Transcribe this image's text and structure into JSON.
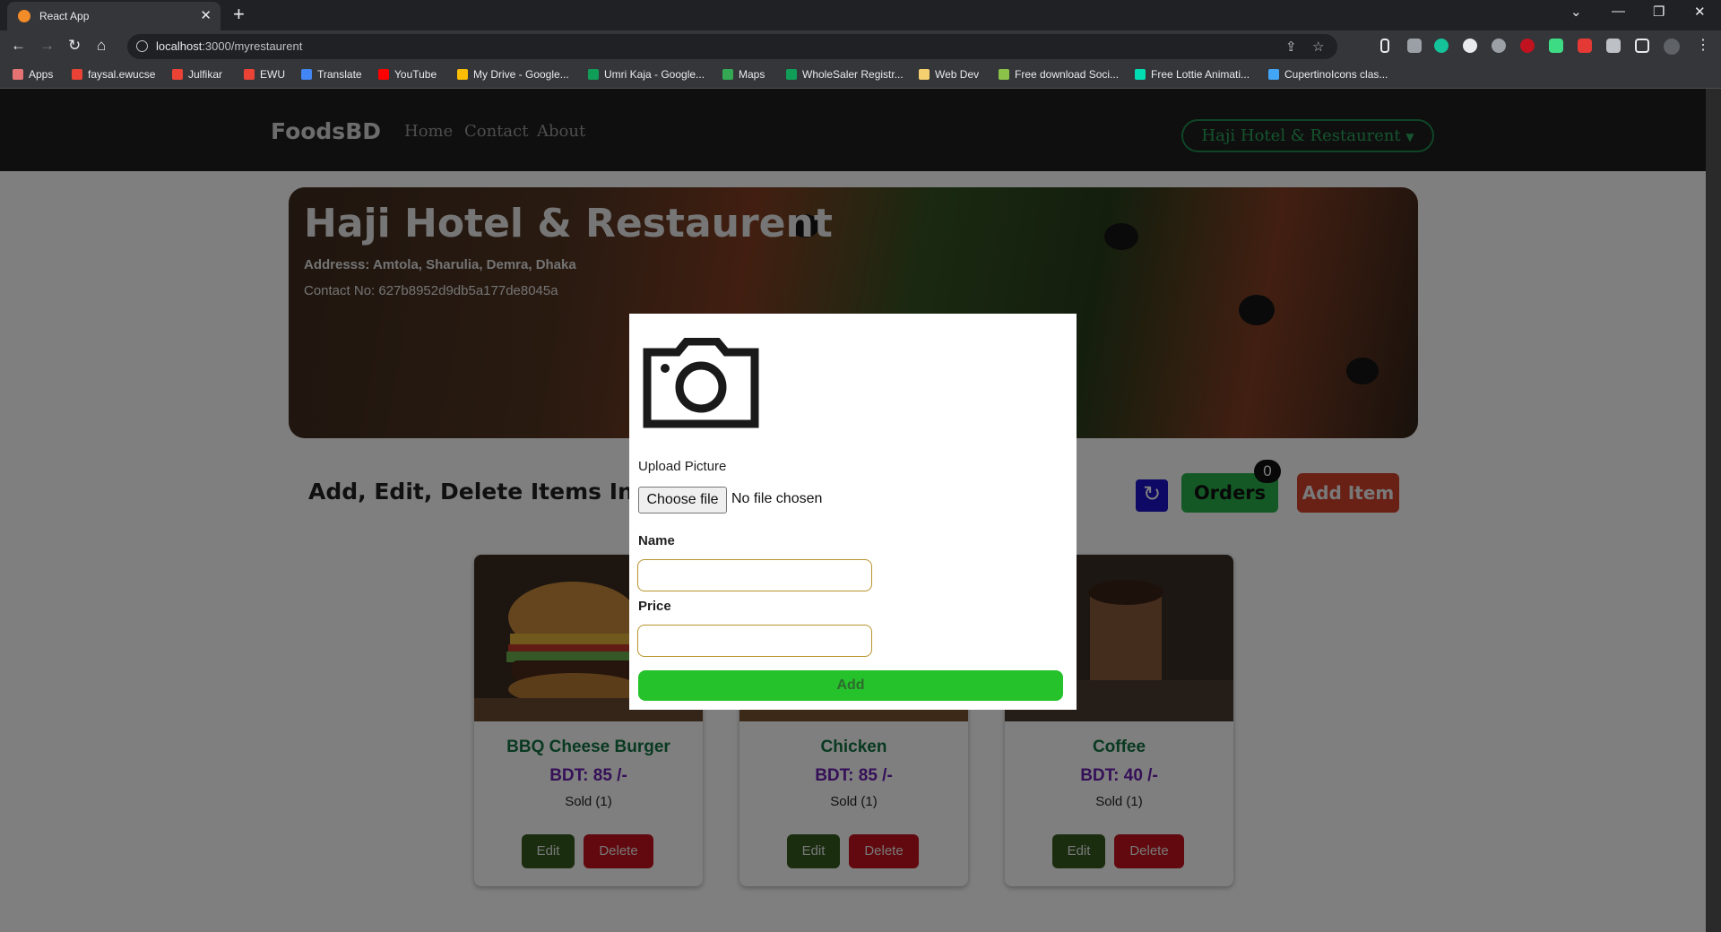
{
  "browser": {
    "tab_title": "React App",
    "url_host": "localhost",
    "url_path": ":3000/myrestaurent",
    "bookmarks": [
      {
        "label": "Apps",
        "icon": "apps-grid-icon",
        "color": "#e57373"
      },
      {
        "label": "faysal.ewucse",
        "icon": "gmail-icon",
        "color": "#ea4335"
      },
      {
        "label": "Julfikar",
        "icon": "gmail-icon",
        "color": "#ea4335"
      },
      {
        "label": "EWU",
        "icon": "gmail-icon",
        "color": "#ea4335"
      },
      {
        "label": "Translate",
        "icon": "translate-icon",
        "color": "#4285f4"
      },
      {
        "label": "YouTube",
        "icon": "youtube-icon",
        "color": "#ff0000"
      },
      {
        "label": "My Drive - Google...",
        "icon": "drive-icon",
        "color": "#fbbc04"
      },
      {
        "label": "Umri Kaja - Google...",
        "icon": "sheets-icon",
        "color": "#0f9d58"
      },
      {
        "label": "Maps",
        "icon": "maps-icon",
        "color": "#34a853"
      },
      {
        "label": "WholeSaler Registr...",
        "icon": "sheets-icon",
        "color": "#0f9d58"
      },
      {
        "label": "Web Dev",
        "icon": "folder-icon",
        "color": "#f4d06f"
      },
      {
        "label": "Free download Soci...",
        "icon": "leaf-icon",
        "color": "#8bc34a"
      },
      {
        "label": "Free Lottie Animati...",
        "icon": "lottie-icon",
        "color": "#00ddb3"
      },
      {
        "label": "CupertinoIcons clas...",
        "icon": "flutter-icon",
        "color": "#42a5f5"
      }
    ]
  },
  "navbar": {
    "brand": "FoodsBD",
    "links": [
      "Home",
      "Contact",
      "About"
    ],
    "restaurant_dropdown": "Haji Hotel & Restaurent"
  },
  "hero": {
    "title": "Haji Hotel & Restaurent",
    "address": "Addresss: Amtola, Sharulia, Demra, Dhaka",
    "contact": "Contact No: 627b8952d9db5a177de8045a"
  },
  "actions": {
    "section_title": "Add, Edit, Delete Items In Your",
    "orders_label": "Orders",
    "orders_count": "0",
    "add_item_label": "Add Item"
  },
  "items": [
    {
      "name": "BBQ Cheese Burger",
      "price": "BDT: 85 /-",
      "sold": "Sold (1)",
      "edit": "Edit",
      "delete": "Delete"
    },
    {
      "name": "Chicken",
      "price": "BDT: 85 /-",
      "sold": "Sold (1)",
      "edit": "Edit",
      "delete": "Delete"
    },
    {
      "name": "Coffee",
      "price": "BDT: 40 /-",
      "sold": "Sold (1)",
      "edit": "Edit",
      "delete": "Delete"
    }
  ],
  "modal": {
    "upload_label": "Upload Picture",
    "choose_file": "Choose file",
    "file_status": "No file chosen",
    "name_label": "Name",
    "name_value": "",
    "price_label": "Price",
    "price_value": "",
    "submit_label": "Add"
  }
}
